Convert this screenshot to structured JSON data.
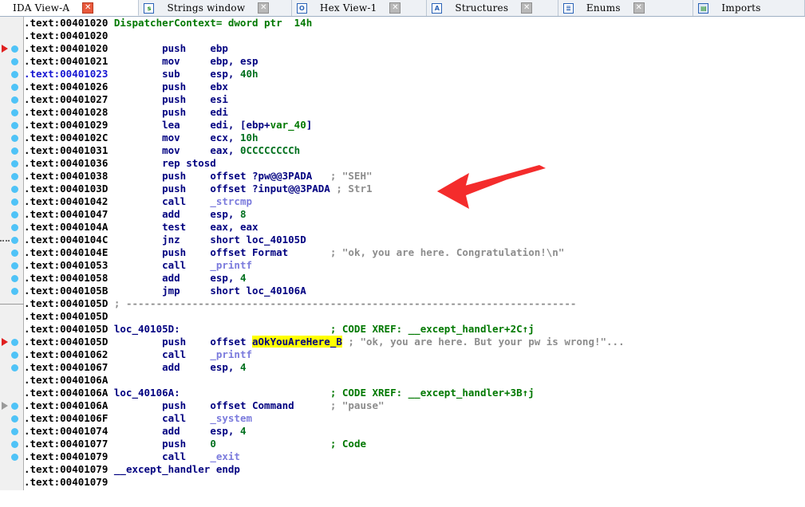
{
  "window": {
    "title": "IDA View-A"
  },
  "tabs": [
    {
      "label": "IDA View-A",
      "icon": "ida-view-icon",
      "active": true,
      "closable": true
    },
    {
      "label": "Strings window",
      "icon": "strings-icon",
      "active": false,
      "closable": true
    },
    {
      "label": "Hex View-1",
      "icon": "hex-view-icon",
      "active": false,
      "closable": true
    },
    {
      "label": "Structures",
      "icon": "structures-icon",
      "active": false,
      "closable": true
    },
    {
      "label": "Enums",
      "icon": "enums-icon",
      "active": false,
      "closable": true
    },
    {
      "label": "Imports",
      "icon": "imports-icon",
      "active": false,
      "closable": false
    }
  ],
  "annotations": {
    "red_arrow": {
      "name": "red-annotation-arrow",
      "points_to": "\"SEH\" string comment",
      "color": "#f42c2c"
    }
  },
  "highlight": {
    "symbol": "aOkYouAreHere_B",
    "background": "#ffff00"
  },
  "colors": {
    "address": "#000000",
    "current_address": "#1414d2",
    "mnemonic": "#000080",
    "number": "#00701e",
    "call_target": "#7b7bdd",
    "comment": "#8c8c8c",
    "xref": "#007800",
    "definition": "#007800",
    "gutter_dot": "#4fc3f7",
    "gutter_bg": "#f0f0f0"
  },
  "listing": [
    {
      "addr": ".text:00401020",
      "gutter": "none",
      "current": false,
      "kind": "def",
      "text": "DispatcherContext= dword ptr  14h"
    },
    {
      "addr": ".text:00401020",
      "gutter": "none",
      "current": false,
      "kind": "blank",
      "text": ""
    },
    {
      "addr": ".text:00401020",
      "gutter": "arrow",
      "current": false,
      "kind": "insn",
      "mnemonic": "push",
      "operands": "ebp",
      "comment": ""
    },
    {
      "addr": ".text:00401021",
      "gutter": "dot",
      "current": false,
      "kind": "insn",
      "mnemonic": "mov",
      "operands": "ebp, esp",
      "comment": ""
    },
    {
      "addr": ".text:00401023",
      "gutter": "dot",
      "current": true,
      "kind": "insn",
      "mnemonic": "sub",
      "operands": "esp, 40h",
      "comment": ""
    },
    {
      "addr": ".text:00401026",
      "gutter": "dot",
      "current": false,
      "kind": "insn",
      "mnemonic": "push",
      "operands": "ebx",
      "comment": ""
    },
    {
      "addr": ".text:00401027",
      "gutter": "dot",
      "current": false,
      "kind": "insn",
      "mnemonic": "push",
      "operands": "esi",
      "comment": ""
    },
    {
      "addr": ".text:00401028",
      "gutter": "dot",
      "current": false,
      "kind": "insn",
      "mnemonic": "push",
      "operands": "edi",
      "comment": ""
    },
    {
      "addr": ".text:00401029",
      "gutter": "dot",
      "current": false,
      "kind": "insn",
      "mnemonic": "lea",
      "operands": "edi, [ebp+var_40]",
      "comment": ""
    },
    {
      "addr": ".text:0040102C",
      "gutter": "dot",
      "current": false,
      "kind": "insn",
      "mnemonic": "mov",
      "operands": "ecx, 10h",
      "comment": ""
    },
    {
      "addr": ".text:00401031",
      "gutter": "dot",
      "current": false,
      "kind": "insn",
      "mnemonic": "mov",
      "operands": "eax, 0CCCCCCCCh",
      "comment": ""
    },
    {
      "addr": ".text:00401036",
      "gutter": "dot",
      "current": false,
      "kind": "insn",
      "mnemonic": "rep stosd",
      "operands": "",
      "comment": ""
    },
    {
      "addr": ".text:00401038",
      "gutter": "dot",
      "current": false,
      "kind": "insn",
      "mnemonic": "push",
      "operands": "offset ?pw@@3PADA",
      "comment": "; \"SEH\""
    },
    {
      "addr": ".text:0040103D",
      "gutter": "dot",
      "current": false,
      "kind": "insn",
      "mnemonic": "push",
      "operands": "offset ?input@@3PADA",
      "comment": "; Str1"
    },
    {
      "addr": ".text:00401042",
      "gutter": "dot",
      "current": false,
      "kind": "call",
      "mnemonic": "call",
      "operands": "_strcmp",
      "comment": ""
    },
    {
      "addr": ".text:00401047",
      "gutter": "dot",
      "current": false,
      "kind": "insn",
      "mnemonic": "add",
      "operands": "esp, 8",
      "comment": ""
    },
    {
      "addr": ".text:0040104A",
      "gutter": "dot",
      "current": false,
      "kind": "insn",
      "mnemonic": "test",
      "operands": "eax, eax",
      "comment": ""
    },
    {
      "addr": ".text:0040104C",
      "gutter": "dash",
      "current": false,
      "kind": "insn",
      "mnemonic": "jnz",
      "operands": "short loc_40105D",
      "comment": ""
    },
    {
      "addr": ".text:0040104E",
      "gutter": "dot",
      "current": false,
      "kind": "insn",
      "mnemonic": "push",
      "operands": "offset Format",
      "comment": "; \"ok, you are here. Congratulation!\\n\""
    },
    {
      "addr": ".text:00401053",
      "gutter": "dot",
      "current": false,
      "kind": "call",
      "mnemonic": "call",
      "operands": "_printf",
      "comment": ""
    },
    {
      "addr": ".text:00401058",
      "gutter": "dot",
      "current": false,
      "kind": "insn",
      "mnemonic": "add",
      "operands": "esp, 4",
      "comment": ""
    },
    {
      "addr": ".text:0040105B",
      "gutter": "dot",
      "current": false,
      "kind": "insn",
      "mnemonic": "jmp",
      "operands": "short loc_40106A",
      "comment": ""
    },
    {
      "addr": ".text:0040105D",
      "gutter": "hline",
      "current": false,
      "kind": "sep",
      "text": "; ---------------------------------------------------------------------------"
    },
    {
      "addr": ".text:0040105D",
      "gutter": "none",
      "current": false,
      "kind": "blank",
      "text": ""
    },
    {
      "addr": ".text:0040105D",
      "gutter": "none",
      "current": false,
      "kind": "loclabel",
      "label": "loc_40105D:",
      "xref": "; CODE XREF: __except_handler+2C↑j"
    },
    {
      "addr": ".text:0040105D",
      "gutter": "arrow",
      "current": false,
      "kind": "insn-hl",
      "mnemonic": "push",
      "operands_prefix": "offset ",
      "operands_hl": "aOkYouAreHere_B",
      "comment": "; \"ok, you are here. But your pw is wrong!\"..."
    },
    {
      "addr": ".text:00401062",
      "gutter": "dot",
      "current": false,
      "kind": "call",
      "mnemonic": "call",
      "operands": "_printf",
      "comment": ""
    },
    {
      "addr": ".text:00401067",
      "gutter": "dot",
      "current": false,
      "kind": "insn",
      "mnemonic": "add",
      "operands": "esp, 4",
      "comment": ""
    },
    {
      "addr": ".text:0040106A",
      "gutter": "none",
      "current": false,
      "kind": "blank",
      "text": ""
    },
    {
      "addr": ".text:0040106A",
      "gutter": "none",
      "current": false,
      "kind": "loclabel",
      "label": "loc_40106A:",
      "xref": "; CODE XREF: __except_handler+3B↑j"
    },
    {
      "addr": ".text:0040106A",
      "gutter": "arrowgrey",
      "current": false,
      "kind": "insn",
      "mnemonic": "push",
      "operands": "offset Command",
      "comment": "; \"pause\""
    },
    {
      "addr": ".text:0040106F",
      "gutter": "dot",
      "current": false,
      "kind": "call",
      "mnemonic": "call",
      "operands": "_system",
      "comment": ""
    },
    {
      "addr": ".text:00401074",
      "gutter": "dot",
      "current": false,
      "kind": "insn",
      "mnemonic": "add",
      "operands": "esp, 4",
      "comment": ""
    },
    {
      "addr": ".text:00401077",
      "gutter": "dot",
      "current": false,
      "kind": "insn",
      "mnemonic": "push",
      "operands": "0",
      "comment": "; Code",
      "comment_style": "xref"
    },
    {
      "addr": ".text:00401079",
      "gutter": "dot",
      "current": false,
      "kind": "call",
      "mnemonic": "call",
      "operands": "_exit",
      "comment": ""
    },
    {
      "addr": ".text:00401079",
      "gutter": "none",
      "current": false,
      "kind": "endp",
      "text": "__except_handler endp"
    },
    {
      "addr": ".text:00401079",
      "gutter": "none",
      "current": false,
      "kind": "blank",
      "text": ""
    }
  ]
}
